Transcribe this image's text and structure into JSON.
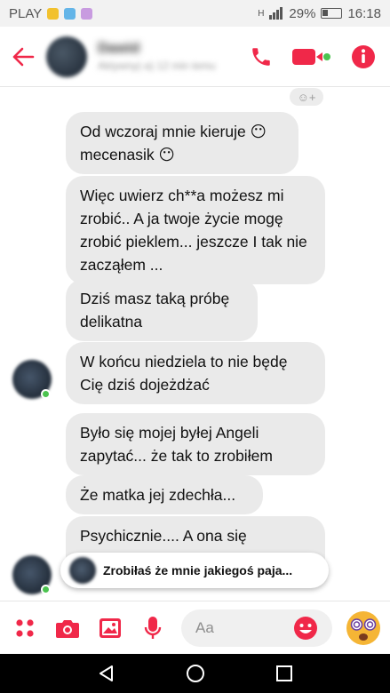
{
  "status_bar": {
    "carrier": "PLAY",
    "battery": "29%",
    "time": "16:18",
    "signal": "H"
  },
  "header": {
    "contact_name": "Dawid",
    "contact_status": "Aktywny(-a) 12 min temu"
  },
  "chat": {
    "add_reaction": "☺+",
    "messages": [
      {
        "text": "Od wczoraj mnie kieruje 😶 mecenasik 😶"
      },
      {
        "text": "Więc uwierz ch**a możesz mi zrobić.. A ja twoje życie mogę zrobić pieklem... jeszcze I tak nie zacząłem ..."
      },
      {
        "text": "Dziś masz taką próbę delikatna"
      },
      {
        "text": "W końcu niedziela to nie będę Cię dziś dojeżdżać"
      },
      {
        "text": "Było się mojej byłej Angeli zapytać... że tak to zrobiłem"
      },
      {
        "text": "Że matka jej zdechła..."
      },
      {
        "text": "Psychicznie.... A ona się"
      }
    ],
    "toast": "Zrobiłaś że mnie jakiegoś paja..."
  },
  "composer": {
    "placeholder": "Aa"
  },
  "colors": {
    "accent": "#f02849",
    "online": "#4bc34f",
    "bubble": "#eaeaea"
  },
  "icons": [
    "back-arrow-icon",
    "phone-icon",
    "video-icon",
    "info-icon",
    "menu-dots-icon",
    "camera-icon",
    "gallery-icon",
    "mic-icon",
    "emoji-icon",
    "back-nav-icon",
    "home-nav-icon",
    "recent-nav-icon"
  ]
}
